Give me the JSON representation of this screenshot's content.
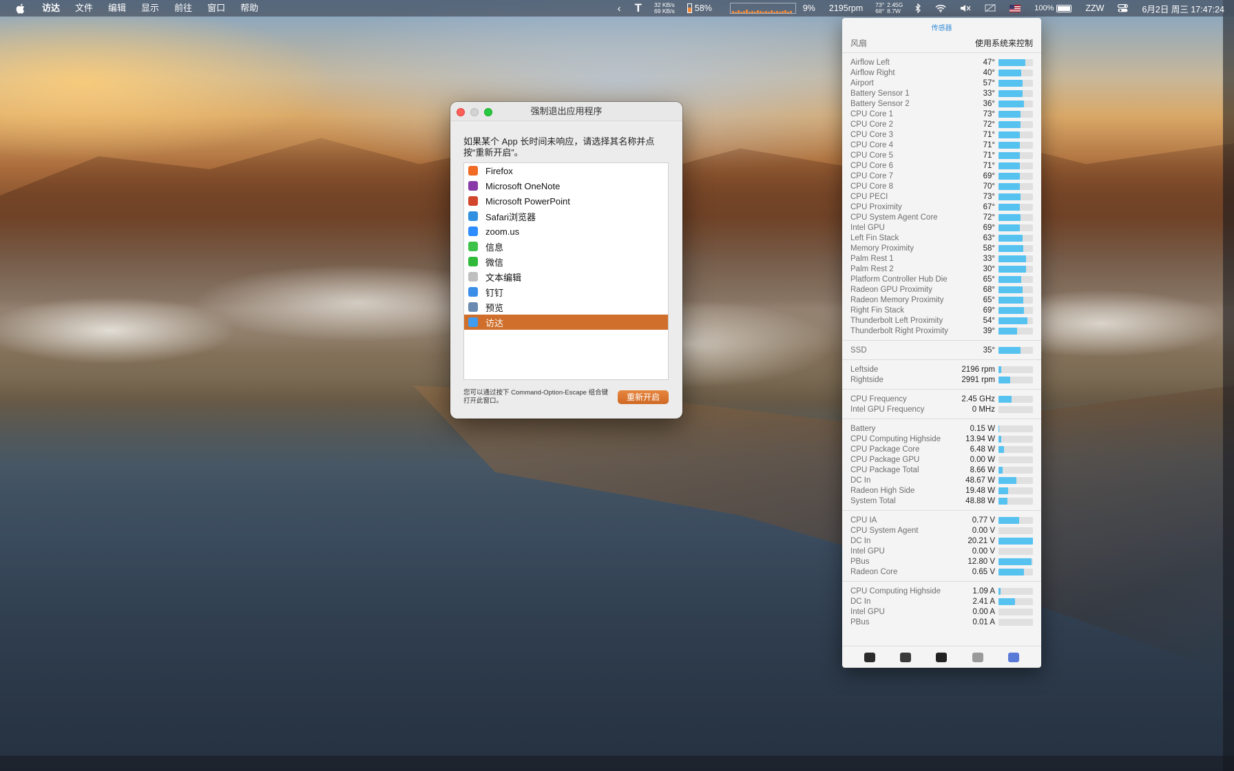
{
  "menubar": {
    "app_name": "访达",
    "menus": [
      "文件",
      "编辑",
      "显示",
      "前往",
      "窗口",
      "帮助"
    ],
    "status": {
      "net_up": "32 KB/s",
      "net_down": "69 KB/s",
      "text_icon": "T",
      "mem_percent": "58%",
      "mem_percent_value": 58,
      "cpu_percent": "9%",
      "fan_rpm": "2195rpm",
      "temp_top": "73°",
      "temp_bottom": "68°",
      "freq": "2.45G",
      "power": "8.7W",
      "battery": "100%",
      "user": "ZZW",
      "datetime": "6月2日 周三  17:47:24"
    }
  },
  "dialog": {
    "title": "强制退出应用程序",
    "description": "如果某个 App 长时间未响应，请选择其名称并点按“重新开启”。",
    "apps": [
      {
        "name": "Firefox",
        "icon": "firefox-icon",
        "color": "#f06a24"
      },
      {
        "name": "Microsoft OneNote",
        "icon": "onenote-icon",
        "color": "#8a3aa8"
      },
      {
        "name": "Microsoft PowerPoint",
        "icon": "powerpoint-icon",
        "color": "#d2462c"
      },
      {
        "name": "Safari浏览器",
        "icon": "safari-icon",
        "color": "#2f8fe0"
      },
      {
        "name": "zoom.us",
        "icon": "zoom-icon",
        "color": "#2d8cff"
      },
      {
        "name": "信息",
        "icon": "messages-icon",
        "color": "#3ec34a"
      },
      {
        "name": "微信",
        "icon": "wechat-icon",
        "color": "#2fba3a"
      },
      {
        "name": "文本编辑",
        "icon": "textedit-icon",
        "color": "#bfbfbf"
      },
      {
        "name": "钉钉",
        "icon": "dingtalk-icon",
        "color": "#3a8ee8"
      },
      {
        "name": "预览",
        "icon": "preview-icon",
        "color": "#6a8ab0"
      },
      {
        "name": "访达",
        "icon": "finder-icon",
        "color": "#3f9cf0"
      }
    ],
    "selected_index": 10,
    "hint": "您可以通过按下 Command-Option-Escape 组合键打开此窗口。",
    "relaunch_label": "重新开启"
  },
  "sensors": {
    "title": "传感器",
    "fan_label": "风扇",
    "fan_mode": "使用系统来控制",
    "temps": [
      {
        "name": "Airflow Left",
        "value": "47°",
        "fill": 0.78
      },
      {
        "name": "Airflow Right",
        "value": "40°",
        "fill": 0.66
      },
      {
        "name": "Airport",
        "value": "57°",
        "fill": 0.7
      },
      {
        "name": "Battery Sensor 1",
        "value": "33°",
        "fill": 0.7
      },
      {
        "name": "Battery Sensor 2",
        "value": "36°",
        "fill": 0.74
      },
      {
        "name": "CPU Core 1",
        "value": "73°",
        "fill": 0.64
      },
      {
        "name": "CPU Core 2",
        "value": "72°",
        "fill": 0.63
      },
      {
        "name": "CPU Core 3",
        "value": "71°",
        "fill": 0.62
      },
      {
        "name": "CPU Core 4",
        "value": "71°",
        "fill": 0.62
      },
      {
        "name": "CPU Core 5",
        "value": "71°",
        "fill": 0.62
      },
      {
        "name": "CPU Core 6",
        "value": "71°",
        "fill": 0.62
      },
      {
        "name": "CPU Core 7",
        "value": "69°",
        "fill": 0.61
      },
      {
        "name": "CPU Core 8",
        "value": "70°",
        "fill": 0.61
      },
      {
        "name": "CPU PECI",
        "value": "73°",
        "fill": 0.64
      },
      {
        "name": "CPU Proximity",
        "value": "67°",
        "fill": 0.62
      },
      {
        "name": "CPU System Agent Core",
        "value": "72°",
        "fill": 0.63
      },
      {
        "name": "Intel GPU",
        "value": "69°",
        "fill": 0.61
      },
      {
        "name": "Left Fin Stack",
        "value": "63°",
        "fill": 0.7
      },
      {
        "name": "Memory Proximity",
        "value": "58°",
        "fill": 0.72
      },
      {
        "name": "Palm Rest 1",
        "value": "33°",
        "fill": 0.8
      },
      {
        "name": "Palm Rest 2",
        "value": "30°",
        "fill": 0.8
      },
      {
        "name": "Platform Controller Hub Die",
        "value": "65°",
        "fill": 0.66
      },
      {
        "name": "Radeon GPU Proximity",
        "value": "68°",
        "fill": 0.7
      },
      {
        "name": "Radeon Memory Proximity",
        "value": "65°",
        "fill": 0.72
      },
      {
        "name": "Right Fin Stack",
        "value": "69°",
        "fill": 0.74
      },
      {
        "name": "Thunderbolt Left Proximity",
        "value": "54°",
        "fill": 0.84
      },
      {
        "name": "Thunderbolt Right Proximity",
        "value": "39°",
        "fill": 0.54
      }
    ],
    "ssd": [
      {
        "name": "SSD",
        "value": "35°",
        "fill": 0.64
      }
    ],
    "fans": [
      {
        "name": "Leftside",
        "value": "2196 rpm",
        "fill": 0.08
      },
      {
        "name": "Rightside",
        "value": "2991 rpm",
        "fill": 0.34
      }
    ],
    "frequencies": [
      {
        "name": "CPU Frequency",
        "value": "2.45 GHz",
        "fill": 0.38
      },
      {
        "name": "Intel GPU Frequency",
        "value": "0 MHz",
        "fill": 0
      }
    ],
    "power": [
      {
        "name": "Battery",
        "value": "0.15 W",
        "fill": 0.02
      },
      {
        "name": "CPU Computing Highside",
        "value": "13.94 W",
        "fill": 0.08
      },
      {
        "name": "CPU Package Core",
        "value": "6.48 W",
        "fill": 0.16
      },
      {
        "name": "CPU Package GPU",
        "value": "0.00 W",
        "fill": 0
      },
      {
        "name": "CPU Package Total",
        "value": "8.66 W",
        "fill": 0.12
      },
      {
        "name": "DC In",
        "value": "48.67 W",
        "fill": 0.52
      },
      {
        "name": "Radeon High Side",
        "value": "19.48 W",
        "fill": 0.28
      },
      {
        "name": "System Total",
        "value": "48.88 W",
        "fill": 0.26
      }
    ],
    "voltages": [
      {
        "name": "CPU IA",
        "value": "0.77 V",
        "fill": 0.6
      },
      {
        "name": "CPU System Agent",
        "value": "0.00 V",
        "fill": 0
      },
      {
        "name": "DC In",
        "value": "20.21 V",
        "fill": 1.0
      },
      {
        "name": "Intel GPU",
        "value": "0.00 V",
        "fill": 0
      },
      {
        "name": "PBus",
        "value": "12.80 V",
        "fill": 0.96
      },
      {
        "name": "Radeon Core",
        "value": "0.65 V",
        "fill": 0.74
      }
    ],
    "currents": [
      {
        "name": "CPU Computing Highside",
        "value": "1.09 A",
        "fill": 0.06
      },
      {
        "name": "DC In",
        "value": "2.41 A",
        "fill": 0.48
      },
      {
        "name": "Intel GPU",
        "value": "0.00 A",
        "fill": 0
      },
      {
        "name": "PBus",
        "value": "0.01 A",
        "fill": 0
      }
    ],
    "footer_icons": [
      {
        "icon": "activity-monitor-icon",
        "color": "#2b2b2b"
      },
      {
        "icon": "console-icon",
        "color": "#3a3a3a"
      },
      {
        "icon": "terminal-icon",
        "color": "#222"
      },
      {
        "icon": "disk-utility-icon",
        "color": "#9a9a9a"
      },
      {
        "icon": "system-info-icon",
        "color": "#5a7ad8"
      }
    ]
  }
}
